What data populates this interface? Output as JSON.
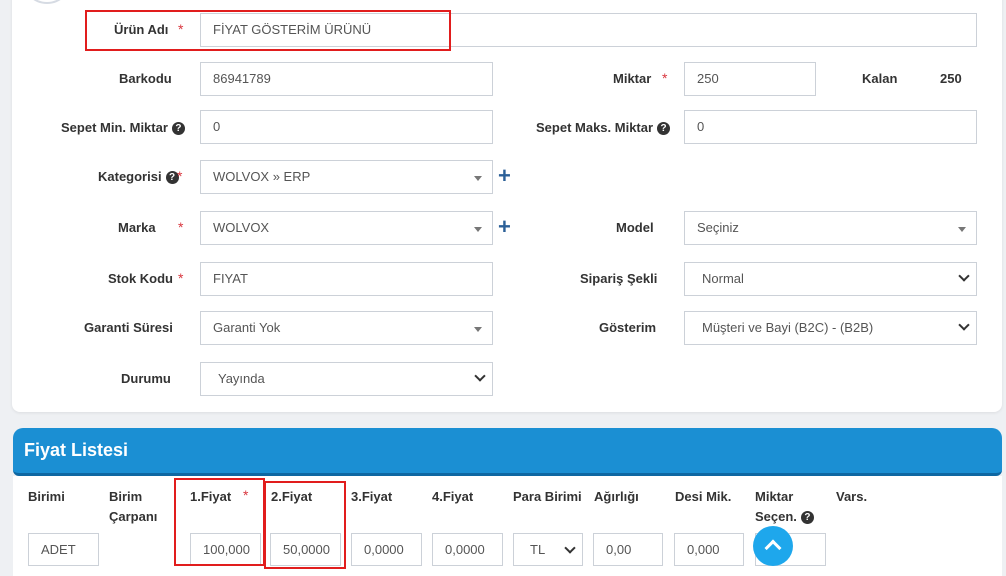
{
  "form": {
    "urun_adi": {
      "label": "Ürün Adı",
      "value": "FİYAT GÖSTERİM ÜRÜNÜ"
    },
    "barkodu": {
      "label": "Barkodu",
      "value": "86941789"
    },
    "miktar": {
      "label": "Miktar",
      "value": "250"
    },
    "kalan": {
      "label": "Kalan",
      "value": "250"
    },
    "sepet_min": {
      "label": "Sepet Min. Miktar",
      "value": "0"
    },
    "sepet_maks": {
      "label": "Sepet Maks. Miktar",
      "value": "0"
    },
    "kategorisi": {
      "label": "Kategorisi",
      "value": "WOLVOX » ERP"
    },
    "marka": {
      "label": "Marka",
      "value": "WOLVOX"
    },
    "model": {
      "label": "Model",
      "value": "Seçiniz"
    },
    "stok_kodu": {
      "label": "Stok Kodu",
      "value": "FIYAT"
    },
    "siparis_sekli": {
      "label": "Sipariş Şekli",
      "value": "Normal"
    },
    "garanti": {
      "label": "Garanti Süresi",
      "value": "Garanti Yok"
    },
    "gosterim": {
      "label": "Gösterim",
      "value": "Müşteri ve Bayi (B2C) - (B2B)"
    },
    "durumu": {
      "label": "Durumu",
      "value": "Yayında"
    },
    "required_mark": "*",
    "plus": "+",
    "help": "?"
  },
  "price_list": {
    "title": "Fiyat Listesi",
    "headers": {
      "birimi": "Birimi",
      "birim_carpani_1": "Birim",
      "birim_carpani_2": "Çarpanı",
      "fiyat1": "1.Fiyat",
      "fiyat2": "2.Fiyat",
      "fiyat3": "3.Fiyat",
      "fiyat4": "4.Fiyat",
      "para_birimi": "Para Birimi",
      "agirligi": "Ağırlığı",
      "desi": "Desi Mik.",
      "miktar_secen_1": "Miktar",
      "miktar_secen_2": "Seçen.",
      "vars": "Vars."
    },
    "values": {
      "birimi": "ADET",
      "fiyat1": "100,000",
      "fiyat2": "50,0000",
      "fiyat3": "0,0000",
      "fiyat4": "0,0000",
      "para_birimi": "TL",
      "agirligi": "0,00",
      "desi": "0,000"
    }
  },
  "colors": {
    "accent": "#1b8fd3",
    "highlight": "#e11d1d",
    "plus": "#2b5f97"
  }
}
